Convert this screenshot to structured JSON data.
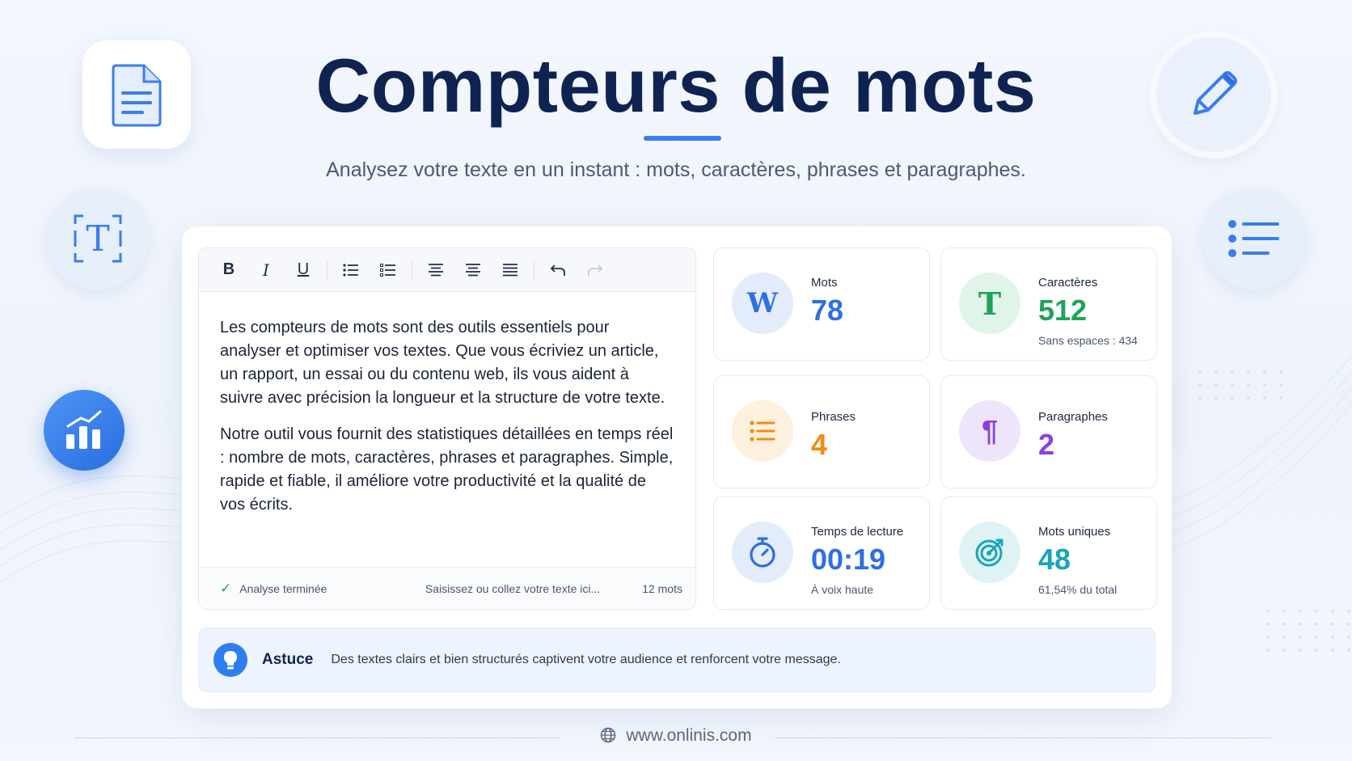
{
  "header": {
    "title": "Compteurs de mots",
    "subtitle": "Analysez votre texte en un instant : mots, caractères, phrases et paragraphes."
  },
  "decor_icons": [
    "document-icon",
    "text-frame-icon",
    "bar-chart-icon",
    "pencil-icon",
    "list-icon"
  ],
  "toolbar": {
    "bold": "B",
    "italic": "I",
    "underline": "U",
    "buttons": [
      "bold-icon",
      "italic-icon",
      "underline-icon",
      "bulleted-list-icon",
      "checklist-icon",
      "align-left-icon",
      "align-center-icon",
      "align-justify-icon",
      "undo-icon",
      "redo-icon"
    ]
  },
  "editor": {
    "paragraphs": [
      "Les compteurs de mots sont des outils essentiels pour analyser et optimiser vos textes. Que vous écriviez un article, un rapport, un essai ou du contenu web, ils vous aident à suivre avec précision la longueur et la structure de votre texte.",
      "Notre outil vous fournit des statistiques détaillées en temps réel : nombre de mots, caractères, phrases et paragraphes. Simple, rapide et fiable, il améliore votre productivité et la qualité de vos écrits."
    ],
    "status": "Analyse terminée",
    "placeholder": "Saisissez ou collez votre texte ici...",
    "word_count": "12 mots"
  },
  "stats": {
    "words": {
      "label": "Mots",
      "value": "78",
      "icon": "W",
      "color": "#2f6fe0",
      "bg": "#e3ecfb"
    },
    "chars": {
      "label": "Caractères",
      "value": "512",
      "sub": "Sans espaces : 434",
      "icon": "T",
      "color": "#1fa35a",
      "bg": "#e1f4e9"
    },
    "sentences": {
      "label": "Phrases",
      "value": "4",
      "icon": "list-icon",
      "color": "#f28c12",
      "bg": "#fdf0dc"
    },
    "paragraphs": {
      "label": "Paragraphes",
      "value": "2",
      "icon": "¶",
      "color": "#8a3fe0",
      "bg": "#efe5fb"
    },
    "reading": {
      "label": "Temps de lecture",
      "value": "00:19",
      "sub": "À voix haute",
      "icon": "stopwatch-icon",
      "color": "#2f6fe0",
      "bg": "#e3ecfb"
    },
    "unique": {
      "label": "Mots uniques",
      "value": "48",
      "sub": "61,54% du total",
      "icon": "target-icon",
      "color": "#16a6b8",
      "bg": "#dff3f4"
    }
  },
  "tip": {
    "title": "Astuce",
    "text": "Des textes clairs et bien structurés captivent votre audience et renforcent votre message."
  },
  "footer": {
    "url": "www.onlinis.com"
  }
}
